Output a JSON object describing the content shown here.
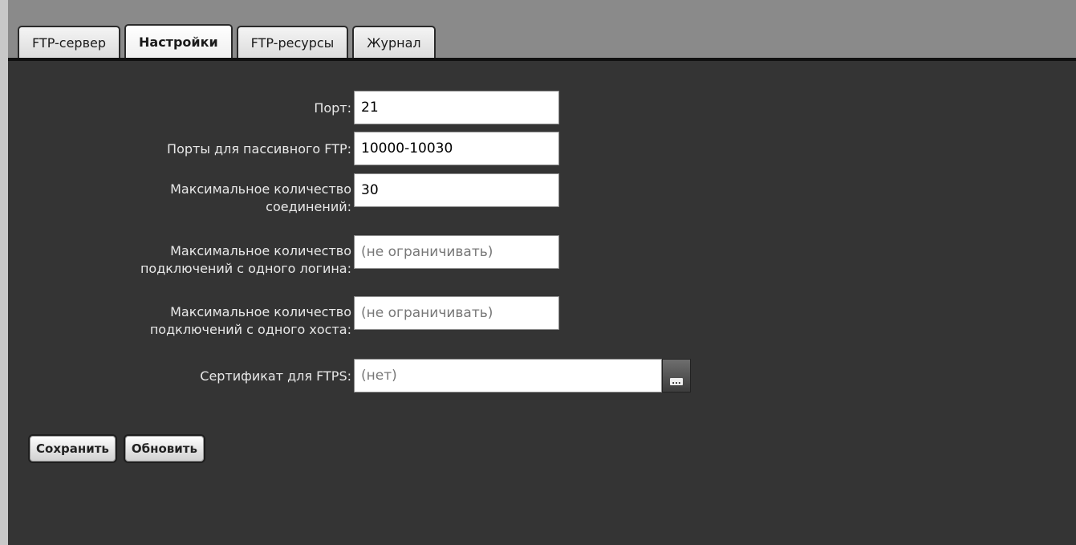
{
  "tabs": [
    {
      "label": "FTP-сервер",
      "active": false
    },
    {
      "label": "Настройки",
      "active": true
    },
    {
      "label": "FTP-ресурсы",
      "active": false
    },
    {
      "label": "Журнал",
      "active": false
    }
  ],
  "form": {
    "port": {
      "label": "Порт:",
      "value": "21"
    },
    "passive_ports": {
      "label": "Порты для пассивного FTP:",
      "value": "10000-10030"
    },
    "max_connections": {
      "label_line1": "Максимальное количество",
      "label_line2": "соединений:",
      "value": "30"
    },
    "max_per_login": {
      "label_line1": "Максимальное количество",
      "label_line2": "подключений с одного логина:",
      "value": "",
      "placeholder": "(не ограничивать)"
    },
    "max_per_host": {
      "label_line1": "Максимальное количество",
      "label_line2": "подключений с одного хоста:",
      "value": "",
      "placeholder": "(не ограничивать)"
    },
    "certificate": {
      "label": "Сертификат для FTPS:",
      "value": "",
      "placeholder": "(нет)",
      "browse_icon": "ellipsis-icon",
      "browse_glyph": "..."
    }
  },
  "actions": {
    "save_label": "Сохранить",
    "refresh_label": "Обновить"
  }
}
